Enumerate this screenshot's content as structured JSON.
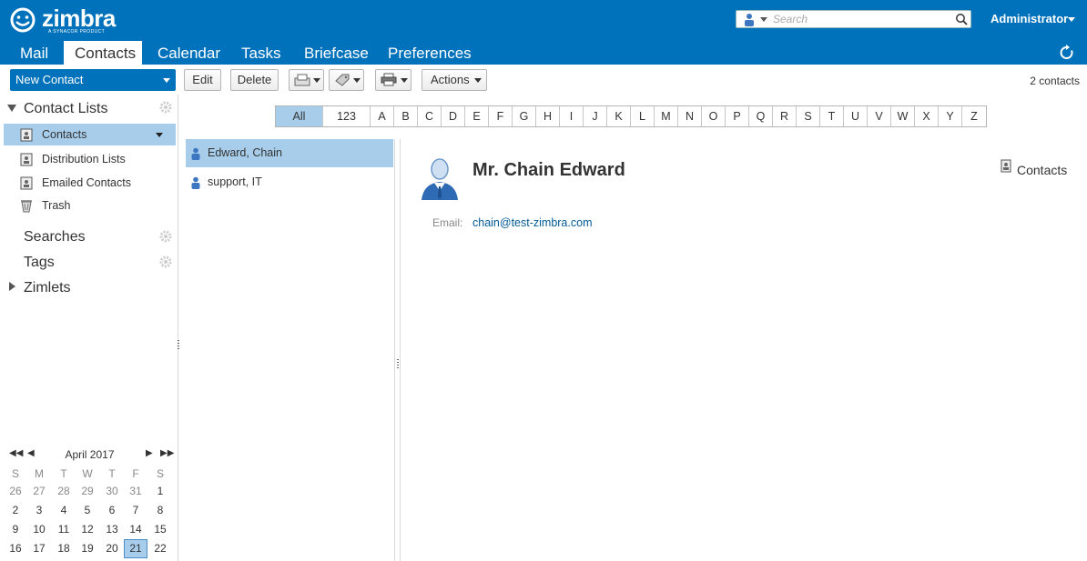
{
  "app": {
    "logo_text": "zimbra",
    "logo_sub": "A SYNACOR PRODUCT",
    "brand_color": "#0071bb",
    "selection_color": "#a7cdeb"
  },
  "header": {
    "search_placeholder": "Search",
    "user_name": "Administrator"
  },
  "tabs": [
    {
      "label": "Mail"
    },
    {
      "label": "Contacts",
      "active": true
    },
    {
      "label": "Calendar"
    },
    {
      "label": "Tasks"
    },
    {
      "label": "Briefcase"
    },
    {
      "label": "Preferences"
    }
  ],
  "toolbar": {
    "new_contact": "New Contact",
    "edit": "Edit",
    "delete": "Delete",
    "actions": "Actions",
    "contact_count": "2 contacts"
  },
  "sidebar": {
    "contact_lists": "Contact Lists",
    "folders": [
      {
        "label": "Contacts",
        "selected": true,
        "icon": "address-book-icon"
      },
      {
        "label": "Distribution Lists",
        "icon": "address-book-icon"
      },
      {
        "label": "Emailed Contacts",
        "icon": "address-book-icon"
      },
      {
        "label": "Trash",
        "icon": "trash-icon"
      }
    ],
    "searches": "Searches",
    "tags": "Tags",
    "zimlets": "Zimlets"
  },
  "calendar": {
    "title": "April 2017",
    "dow": [
      "S",
      "M",
      "T",
      "W",
      "T",
      "F",
      "S"
    ],
    "weeks": [
      [
        {
          "d": "26",
          "other": true
        },
        {
          "d": "27",
          "other": true
        },
        {
          "d": "28",
          "other": true
        },
        {
          "d": "29",
          "other": true
        },
        {
          "d": "30",
          "other": true
        },
        {
          "d": "31",
          "other": true
        },
        {
          "d": "1"
        }
      ],
      [
        {
          "d": "2"
        },
        {
          "d": "3"
        },
        {
          "d": "4"
        },
        {
          "d": "5"
        },
        {
          "d": "6"
        },
        {
          "d": "7"
        },
        {
          "d": "8"
        }
      ],
      [
        {
          "d": "9"
        },
        {
          "d": "10"
        },
        {
          "d": "11"
        },
        {
          "d": "12"
        },
        {
          "d": "13"
        },
        {
          "d": "14"
        },
        {
          "d": "15"
        }
      ],
      [
        {
          "d": "16"
        },
        {
          "d": "17"
        },
        {
          "d": "18"
        },
        {
          "d": "19"
        },
        {
          "d": "20"
        },
        {
          "d": "21",
          "today": true
        },
        {
          "d": "22"
        }
      ]
    ]
  },
  "alphabet": [
    "All",
    "123",
    "A",
    "B",
    "C",
    "D",
    "E",
    "F",
    "G",
    "H",
    "I",
    "J",
    "K",
    "L",
    "M",
    "N",
    "O",
    "P",
    "Q",
    "R",
    "S",
    "T",
    "U",
    "V",
    "W",
    "X",
    "Y",
    "Z"
  ],
  "contacts": [
    {
      "name": "Edward, Chain",
      "selected": true
    },
    {
      "name": "support, IT"
    }
  ],
  "detail": {
    "full_name": "Mr. Chain Edward",
    "folder": "Contacts",
    "email_label": "Email:",
    "email": "chain@test-zimbra.com"
  }
}
